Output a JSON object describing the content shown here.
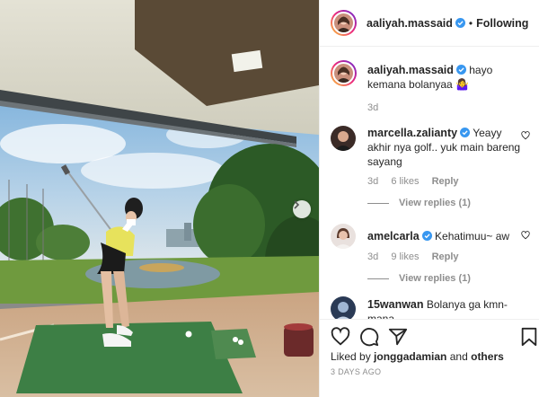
{
  "header": {
    "username": "aaliyah.massaid",
    "separator": "•",
    "follow_status": "Following"
  },
  "caption": {
    "username": "aaliyah.massaid",
    "text": "hayo kemana bolanyaa 🤷‍♀️",
    "time": "3d"
  },
  "comments": [
    {
      "username": "marcella.zalianty",
      "verified": true,
      "text": "Yeayy akhir nya golf.. yuk main bareng sayang",
      "time": "3d",
      "likes": "6 likes",
      "reply_label": "Reply",
      "view_replies": "View replies (1)"
    },
    {
      "username": "amelcarla",
      "verified": true,
      "text": "Kehatimuu~ aw",
      "time": "3d",
      "likes": "9 likes",
      "reply_label": "Reply",
      "view_replies": "View replies (1)"
    },
    {
      "username": "15wanwan",
      "verified": false,
      "text": "Bolanya ga kmn-mana"
    }
  ],
  "actions": {
    "icons": [
      "heart-icon",
      "comment-icon",
      "share-icon",
      "bookmark-icon"
    ],
    "liked_prefix": "Liked by",
    "liked_user": "jonggadamian",
    "liked_and": "and",
    "liked_others": "others",
    "date": "3 DAYS AGO"
  },
  "colors": {
    "text": "#262626",
    "muted": "#8e8e8e",
    "verified": "#3897f0",
    "divider": "#efefef"
  }
}
